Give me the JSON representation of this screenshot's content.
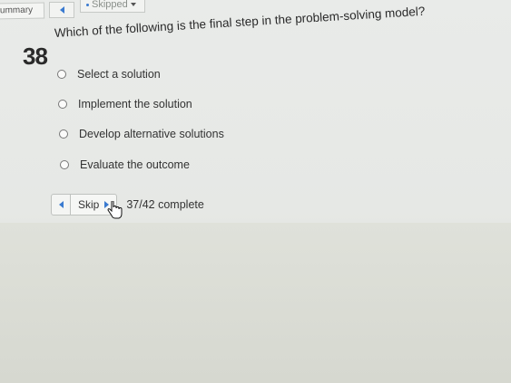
{
  "header": {
    "summary_label": "ummary",
    "skipped_label": "Skipped"
  },
  "question": {
    "number": "38",
    "text": "Which of the following is the final step in the problem-solving model?",
    "options": [
      {
        "label": "Select a solution",
        "selected": false
      },
      {
        "label": "Implement the solution",
        "selected": false
      },
      {
        "label": "Develop alternative solutions",
        "selected": false
      },
      {
        "label": "Evaluate the outcome",
        "selected": false
      }
    ]
  },
  "navigation": {
    "skip_label": "Skip",
    "progress_text": "37/42 complete"
  },
  "colors": {
    "accent": "#3a7ad0",
    "background": "#e8eae8"
  }
}
